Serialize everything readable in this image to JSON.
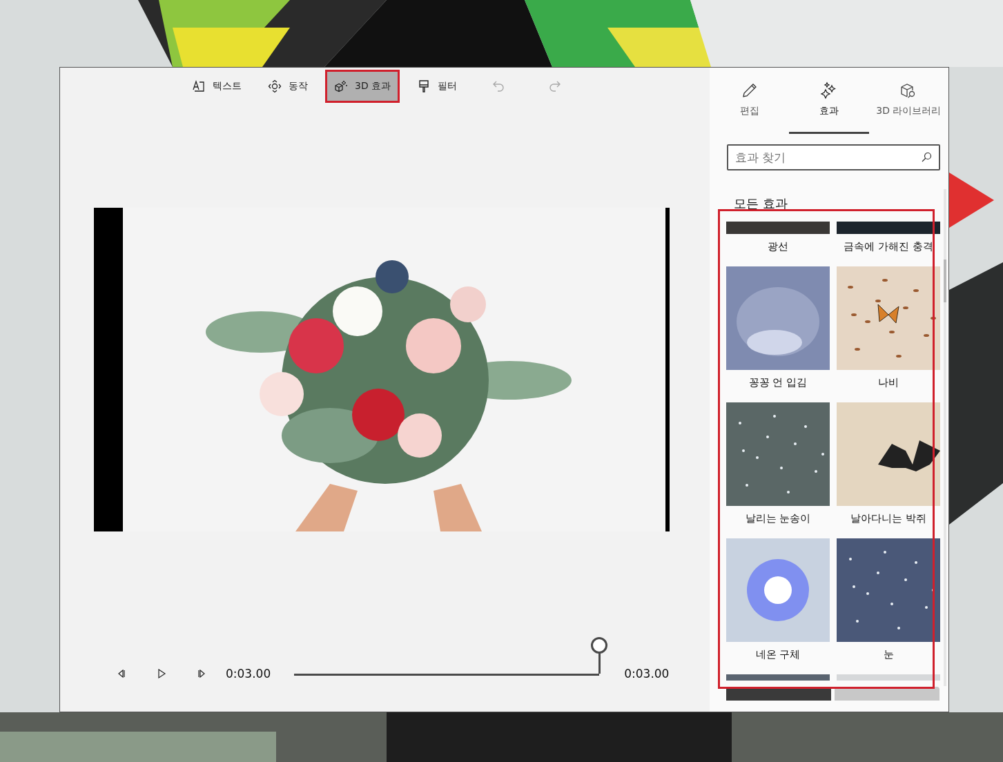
{
  "toolbar": [
    {
      "kind": "text",
      "label": "텍스트",
      "selected": false
    },
    {
      "kind": "motion",
      "label": "동작",
      "selected": false
    },
    {
      "kind": "effects3d",
      "label": "3D 효과",
      "selected": true
    },
    {
      "kind": "filter",
      "label": "필터",
      "selected": false
    },
    {
      "kind": "undo",
      "disabled": true
    },
    {
      "kind": "redo",
      "disabled": true
    }
  ],
  "player": {
    "current_time": "0:03.00",
    "total_time": "0:03.00",
    "level": 1.0
  },
  "panel": {
    "tabs": [
      {
        "kind": "edit",
        "label": "편집",
        "selected": false
      },
      {
        "kind": "effects",
        "label": "효과",
        "selected": true
      },
      {
        "kind": "library",
        "label": "3D 라이브러리",
        "selected": false
      }
    ],
    "search": {
      "placeholder": "효과 찾기"
    },
    "heading": "모든 효과",
    "grid_highlighted": true,
    "effects": [
      {
        "kind": "rays",
        "label": "광선"
      },
      {
        "kind": "metal",
        "label": "금속에 가해진 충격"
      },
      {
        "kind": "breath",
        "label": "꽁꽁 언 입김"
      },
      {
        "kind": "butterfly",
        "label": "나비"
      },
      {
        "kind": "snowflakes",
        "label": "날리는 눈송이"
      },
      {
        "kind": "bats",
        "label": "날아다니는 박쥐"
      },
      {
        "kind": "neon",
        "label": "네온 구체"
      },
      {
        "kind": "snow",
        "label": "눈"
      },
      {
        "kind": "steel"
      },
      {
        "kind": "mist"
      }
    ]
  }
}
